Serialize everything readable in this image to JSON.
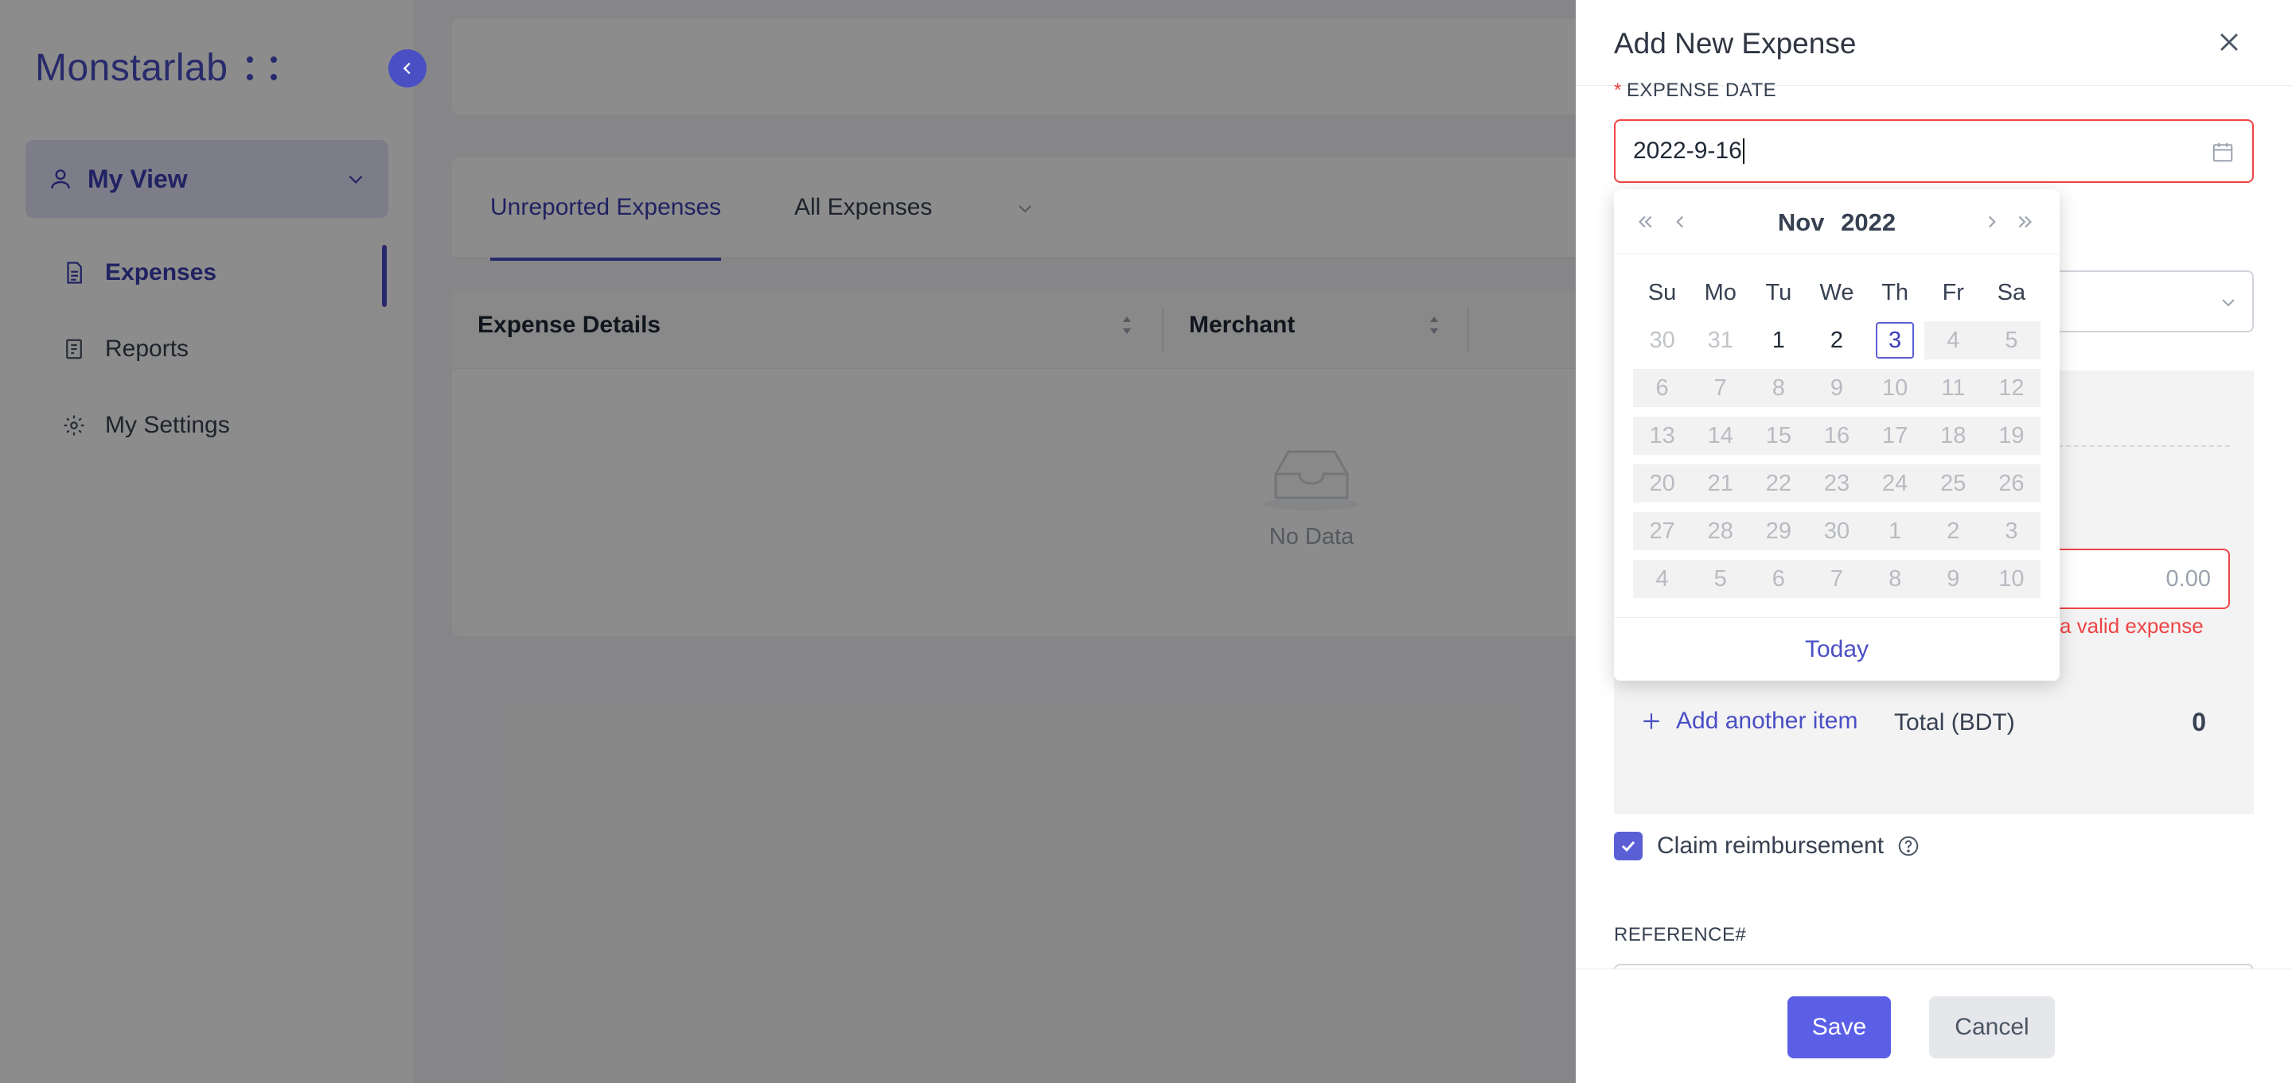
{
  "app": {
    "brand": "Monstarlab"
  },
  "sidebar": {
    "view_selector": "My View",
    "items": [
      {
        "label": "Expenses",
        "active": true
      },
      {
        "label": "Reports",
        "active": false
      },
      {
        "label": "My Settings",
        "active": false
      }
    ]
  },
  "main": {
    "tabs": [
      {
        "label": "Unreported Expenses"
      },
      {
        "label": "All Expenses"
      }
    ],
    "columns": [
      {
        "label": "Expense Details"
      },
      {
        "label": "Merchant"
      }
    ],
    "empty_text": "No Data"
  },
  "drawer": {
    "title": "Add New Expense",
    "expense_date_label": "EXPENSE DATE",
    "expense_date_value": "2022-9-16",
    "amount_placeholder": "0.00",
    "amount_error": "a valid expense",
    "add_item_label": "Add another item",
    "total_label": "Total (BDT)",
    "total_value": "0",
    "claim_label": "Claim reimbursement",
    "claim_checked": true,
    "reference_label": "REFERENCE#",
    "save_label": "Save",
    "cancel_label": "Cancel"
  },
  "datepicker": {
    "month": "Nov",
    "year": "2022",
    "weekdays": [
      "Su",
      "Mo",
      "Tu",
      "We",
      "Th",
      "Fr",
      "Sa"
    ],
    "today_label": "Today",
    "days": [
      [
        "30",
        "31",
        "1",
        "2",
        "3",
        "4",
        "5"
      ],
      [
        "6",
        "7",
        "8",
        "9",
        "10",
        "11",
        "12"
      ],
      [
        "13",
        "14",
        "15",
        "16",
        "17",
        "18",
        "19"
      ],
      [
        "20",
        "21",
        "22",
        "23",
        "24",
        "25",
        "26"
      ],
      [
        "27",
        "28",
        "29",
        "30",
        "1",
        "2",
        "3"
      ],
      [
        "4",
        "5",
        "6",
        "7",
        "8",
        "9",
        "10"
      ]
    ],
    "today_day": "3"
  },
  "colors": {
    "accent": "#4a4fc4",
    "error": "#ef4444",
    "primary_button": "#5b5fe6"
  }
}
